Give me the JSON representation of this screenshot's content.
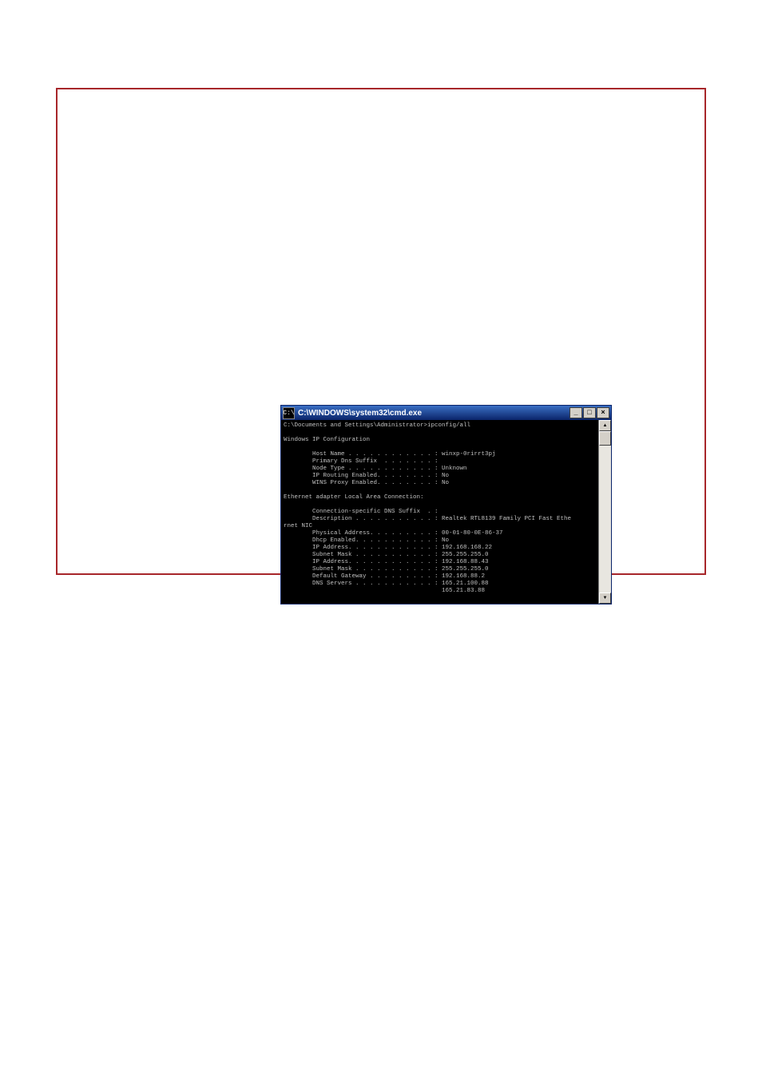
{
  "window": {
    "title": "C:\\WINDOWS\\system32\\cmd.exe",
    "sys_icon_label": "C:\\",
    "buttons": {
      "minimize": "_",
      "maximize": "□",
      "close": "×"
    }
  },
  "console": {
    "prompt_line": "C:\\Documents and Settings\\Administrator>ipconfig/all",
    "section1_header": "Windows IP Configuration",
    "section1": [
      {
        "label": "Host Name . . . . . . . . . . . . ",
        "value": ": winxp-0rirrt3pj"
      },
      {
        "label": "Primary Dns Suffix  . . . . . . . ",
        "value": ":"
      },
      {
        "label": "Node Type . . . . . . . . . . . . ",
        "value": ": Unknown"
      },
      {
        "label": "IP Routing Enabled. . . . . . . . ",
        "value": ": No"
      },
      {
        "label": "WINS Proxy Enabled. . . . . . . . ",
        "value": ": No"
      }
    ],
    "section2_header": "Ethernet adapter Local Area Connection:",
    "section2": [
      {
        "label": "Connection-specific DNS Suffix  . ",
        "value": ":"
      },
      {
        "label": "Description . . . . . . . . . . . ",
        "value": ": Realtek RTL8139 Family PCI Fast Ethe"
      },
      {
        "label_cont": "rnet NIC",
        "value": ""
      },
      {
        "label": "Physical Address. . . . . . . . . ",
        "value": ": 00-01-80-0E-86-37"
      },
      {
        "label": "Dhcp Enabled. . . . . . . . . . . ",
        "value": ": No"
      },
      {
        "label": "IP Address. . . . . . . . . . . . ",
        "value": ": 192.168.168.22"
      },
      {
        "label": "Subnet Mask . . . . . . . . . . . ",
        "value": ": 255.255.255.0"
      },
      {
        "label": "IP Address. . . . . . . . . . . . ",
        "value": ": 192.168.88.43"
      },
      {
        "label": "Subnet Mask . . . . . . . . . . . ",
        "value": ": 255.255.255.0"
      },
      {
        "label": "Default Gateway . . . . . . . . . ",
        "value": ": 192.168.88.2"
      },
      {
        "label": "DNS Servers . . . . . . . . . . . ",
        "value": ": 165.21.100.88"
      },
      {
        "label": "                                    ",
        "value": "165.21.83.88"
      }
    ]
  }
}
